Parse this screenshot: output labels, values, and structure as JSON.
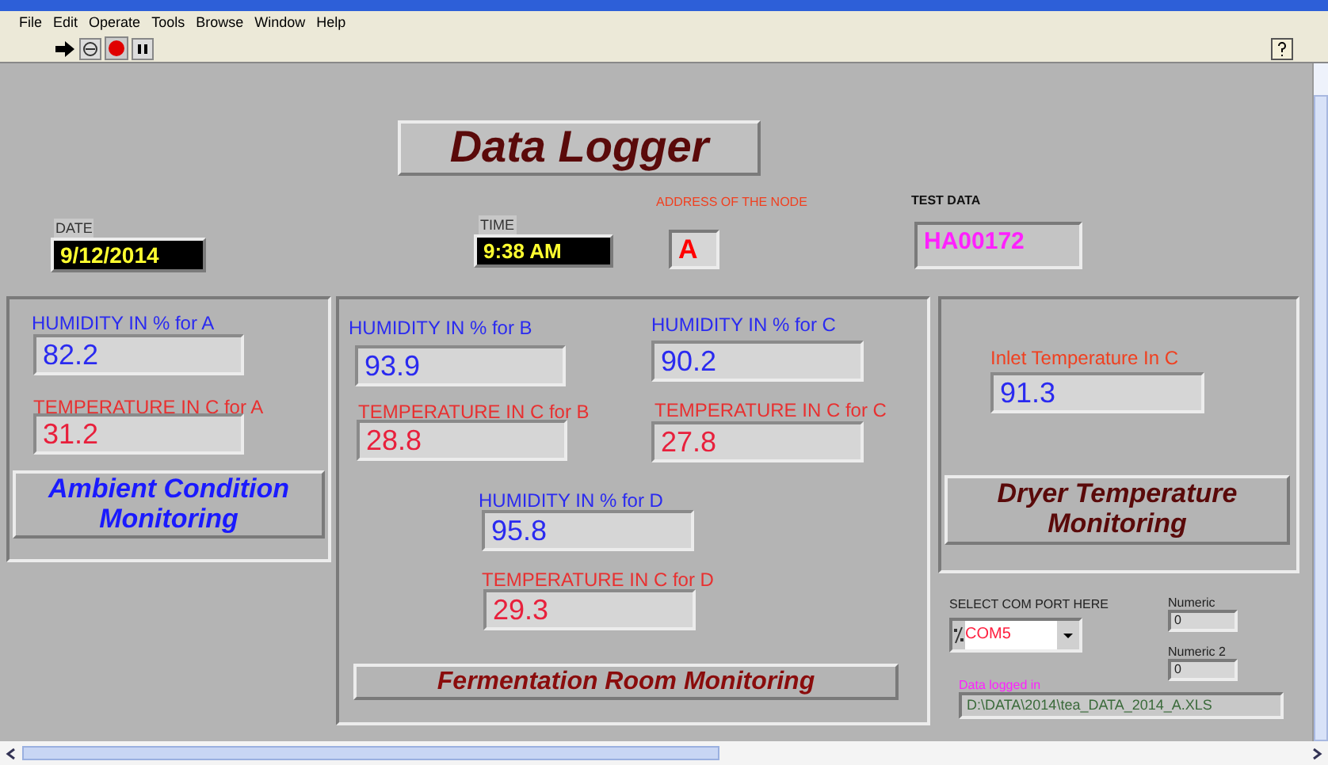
{
  "menu": [
    "File",
    "Edit",
    "Operate",
    "Tools",
    "Browse",
    "Window",
    "Help"
  ],
  "title": "Data Logger",
  "date": {
    "label": "DATE",
    "value": "9/12/2014"
  },
  "time": {
    "label": "TIME",
    "value": "9:38 AM"
  },
  "node_address": {
    "label": "ADDRESS OF THE NODE",
    "value": "A"
  },
  "test_data": {
    "label": "TEST DATA",
    "value": "HA00172"
  },
  "ambient": {
    "button": "Ambient Condition Monitoring",
    "indicators": [
      {
        "kind": "humidity",
        "label": "HUMIDITY IN % for A",
        "value": "82.2"
      },
      {
        "kind": "temperature",
        "label": "TEMPERATURE IN C for A",
        "value": "31.2"
      }
    ]
  },
  "fermentation": {
    "button": "Fermentation Room Monitoring",
    "indicators": [
      {
        "kind": "humidity",
        "label": "HUMIDITY IN % for B",
        "value": "93.9"
      },
      {
        "kind": "temperature",
        "label": "TEMPERATURE IN C for B",
        "value": "28.8"
      },
      {
        "kind": "humidity",
        "label": "HUMIDITY IN % for C",
        "value": "90.2"
      },
      {
        "kind": "temperature",
        "label": "TEMPERATURE IN C for C",
        "value": "27.8"
      },
      {
        "kind": "humidity",
        "label": "HUMIDITY IN % for D",
        "value": "95.8"
      },
      {
        "kind": "temperature",
        "label": "TEMPERATURE IN C for D",
        "value": "29.3"
      }
    ]
  },
  "dryer": {
    "button": "Dryer Temperature Monitoring",
    "indicators": [
      {
        "kind": "inlet",
        "label": "Inlet Temperature In C",
        "value": "91.3"
      }
    ]
  },
  "com_port": {
    "label": "SELECT COM PORT HERE",
    "value": "COM5"
  },
  "numerics": [
    {
      "label": "Numeric",
      "value": "0"
    },
    {
      "label": "Numeric 2",
      "value": "0"
    }
  ],
  "data_logged": {
    "label": "Data logged in",
    "value": "D:\\DATA\\2014\\tea_DATA_2014_A.XLS"
  }
}
